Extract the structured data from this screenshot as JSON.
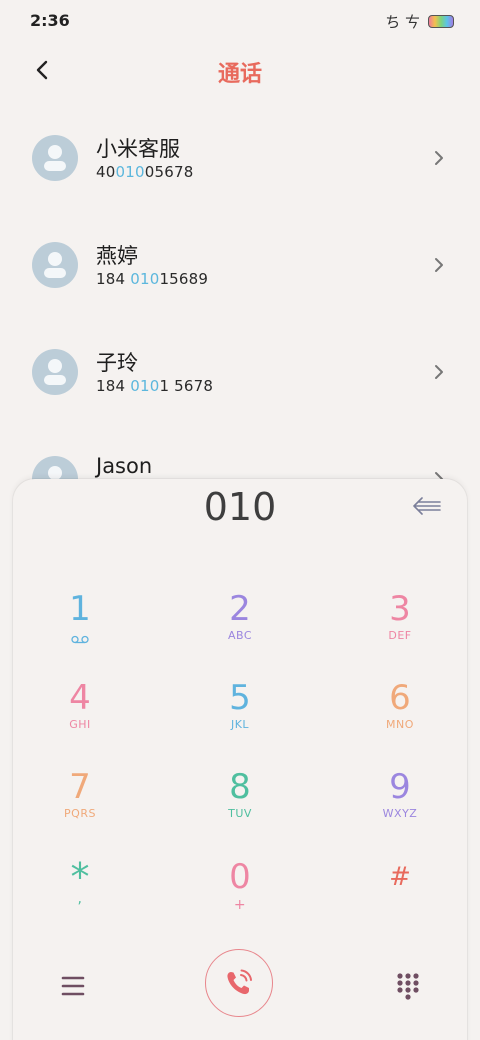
{
  "status_bar": {
    "time": "2:36",
    "glyphs": "ち ㄘ"
  },
  "header": {
    "title": "通话",
    "back_icon": "chevron-left-icon"
  },
  "contacts": [
    {
      "name": "小米客服",
      "number_pre": "40",
      "number_hl": "010",
      "number_post": "05678"
    },
    {
      "name": "燕婷",
      "number_pre": "184 ",
      "number_hl": "010",
      "number_post": "15689"
    },
    {
      "name": "子玲",
      "number_pre": "184 ",
      "number_hl": "010",
      "number_post": "1 5678"
    },
    {
      "name": "Jason",
      "number_pre": "",
      "number_hl": "",
      "number_post": ""
    }
  ],
  "dialer": {
    "display": "010",
    "keys": [
      {
        "digit": "1",
        "letters": "",
        "color": "#5fb3de",
        "letter_color": "#5fb3de"
      },
      {
        "digit": "2",
        "letters": "ABC",
        "color": "#9b86df",
        "letter_color": "#9b86df"
      },
      {
        "digit": "3",
        "letters": "DEF",
        "color": "#ee86a3",
        "letter_color": "#ee86a3"
      },
      {
        "digit": "4",
        "letters": "GHI",
        "color": "#ee86a3",
        "letter_color": "#ee86a3"
      },
      {
        "digit": "5",
        "letters": "JKL",
        "color": "#5fb3de",
        "letter_color": "#5fb3de"
      },
      {
        "digit": "6",
        "letters": "MNO",
        "color": "#f0a97a",
        "letter_color": "#f0a97a"
      },
      {
        "digit": "7",
        "letters": "PQRS",
        "color": "#f0a97a",
        "letter_color": "#f0a97a"
      },
      {
        "digit": "8",
        "letters": "TUV",
        "color": "#4fbf9f",
        "letter_color": "#4fbf9f"
      },
      {
        "digit": "9",
        "letters": "WXYZ",
        "color": "#9b86df",
        "letter_color": "#9b86df"
      },
      {
        "digit": "*",
        "letters": ",",
        "color": "#4fbf9f",
        "letter_color": "#4fbf9f"
      },
      {
        "digit": "0",
        "letters": "+",
        "color": "#ee86a3",
        "letter_color": "#ee86a3"
      },
      {
        "digit": "#",
        "letters": "",
        "color": "#e86a5d",
        "letter_color": "#e86a5d"
      }
    ]
  },
  "colors": {
    "accent": "#e86a5d",
    "highlight": "#5cb7dd",
    "avatar": "#bccdd8"
  }
}
